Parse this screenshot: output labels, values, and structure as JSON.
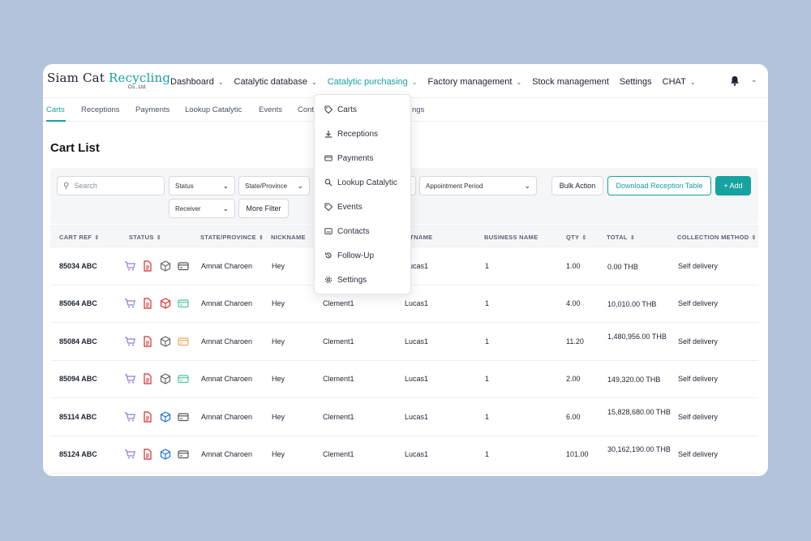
{
  "app": {
    "logo_text_main": "Siam Cat ",
    "logo_text_accent": "Recycling",
    "logo_subtitle": "Co., Ltd."
  },
  "nav": {
    "items": [
      {
        "label": "Dashboard",
        "chevron": "⌄"
      },
      {
        "label": "Catalytic database",
        "chevron": "⌄"
      },
      {
        "label": "Catalytic purchasing",
        "chevron": "⌄"
      },
      {
        "label": "Factory management",
        "chevron": "⌄"
      },
      {
        "label": "Stock management",
        "chevron": ""
      },
      {
        "label": "Settings",
        "chevron": ""
      },
      {
        "label": "CHAT",
        "chevron": "⌄"
      }
    ],
    "active_index": 2
  },
  "subnav": {
    "items": [
      "Carts",
      "Receptions",
      "Payments",
      "Lookup Catalytic",
      "Events",
      "Cont",
      "ngs"
    ]
  },
  "page": {
    "title": "Cart List"
  },
  "filters": {
    "search_placeholder": "Search",
    "status": "Status",
    "state_province": "State/Province",
    "appointment_period": "Appointment Period",
    "receiver": "Receiver",
    "more_filter": "More Filter",
    "bulk_action": "Bulk Action",
    "download": "Download Reception Table",
    "add": "+  Add"
  },
  "dropdown": {
    "items": [
      {
        "label": "Carts",
        "icon": "tag-icon"
      },
      {
        "label": "Receptions",
        "icon": "download-icon"
      },
      {
        "label": "Payments",
        "icon": "credit-card-icon"
      },
      {
        "label": "Lookup Catalytic",
        "icon": "search-icon"
      },
      {
        "label": "Events",
        "icon": "tag-icon"
      },
      {
        "label": "Contacts",
        "icon": "contact-card-icon"
      },
      {
        "label": "Follow-Up",
        "icon": "history-icon"
      },
      {
        "label": "Settings",
        "icon": "gear-icon"
      }
    ]
  },
  "table": {
    "columns": [
      "CART REF",
      "STATUS",
      "STATE/PROVINCE",
      "NICKNAME",
      "",
      "LASTNAME",
      "BUSINESS NAME",
      "QTY",
      "TOTAL",
      "COLLECTION METHOD"
    ],
    "lastname_partial": "STNAME",
    "rows": [
      {
        "ref": "85034 ABC",
        "state": "Amnat Charoen",
        "nickname": "Hey",
        "firstname": "",
        "lastname": "Lucas1",
        "business": "1",
        "qty": "1.00",
        "total": "0.00 THB",
        "method": "Self delivery",
        "status_colors": [
          "#8b7fd9",
          "#d32f2f",
          "#666666",
          "#555555"
        ]
      },
      {
        "ref": "85064 ABC",
        "state": "Amnat Charoen",
        "nickname": "Hey",
        "firstname": "Clement1",
        "lastname": "Lucas1",
        "business": "1",
        "qty": "4.00",
        "total": "10,010.00 THB",
        "method": "Self delivery",
        "status_colors": [
          "#8b7fd9",
          "#d32f2f",
          "#d32f2f",
          "#4fc3a1"
        ]
      },
      {
        "ref": "85084 ABC",
        "state": "Amnat Charoen",
        "nickname": "Hey",
        "firstname": "Clement1",
        "lastname": "Lucas1",
        "business": "1",
        "qty": "11.20",
        "total": "1,480,956.00 THB",
        "method": "Self delivery",
        "status_colors": [
          "#8b7fd9",
          "#d32f2f",
          "#666666",
          "#f5a45c"
        ]
      },
      {
        "ref": "85094 ABC",
        "state": "Amnat Charoen",
        "nickname": "Hey",
        "firstname": "Clement1",
        "lastname": "Lucas1",
        "business": "1",
        "qty": "2.00",
        "total": "149,320.00 THB",
        "method": "Self delivery",
        "status_colors": [
          "#8b7fd9",
          "#d32f2f",
          "#666666",
          "#4fc3a1"
        ]
      },
      {
        "ref": "85114 ABC",
        "state": "Amnat Charoen",
        "nickname": "Hey",
        "firstname": "Clement1",
        "lastname": "Lucas1",
        "business": "1",
        "qty": "6.00",
        "total": "15,828,680.00 THB",
        "method": "Self delivery",
        "status_colors": [
          "#8b7fd9",
          "#d32f2f",
          "#1e6fd9",
          "#555555"
        ]
      },
      {
        "ref": "85124 ABC",
        "state": "Amnat Charoen",
        "nickname": "Hey",
        "firstname": "Clement1",
        "lastname": "Lucas1",
        "business": "1",
        "qty": "101.00",
        "total": "30,162,190.00 THB",
        "method": "Self delivery",
        "status_colors": [
          "#8b7fd9",
          "#d32f2f",
          "#1e6fd9",
          "#555555"
        ]
      }
    ]
  },
  "colors": {
    "accent": "#17a2a2",
    "background": "#b3c3dc"
  }
}
